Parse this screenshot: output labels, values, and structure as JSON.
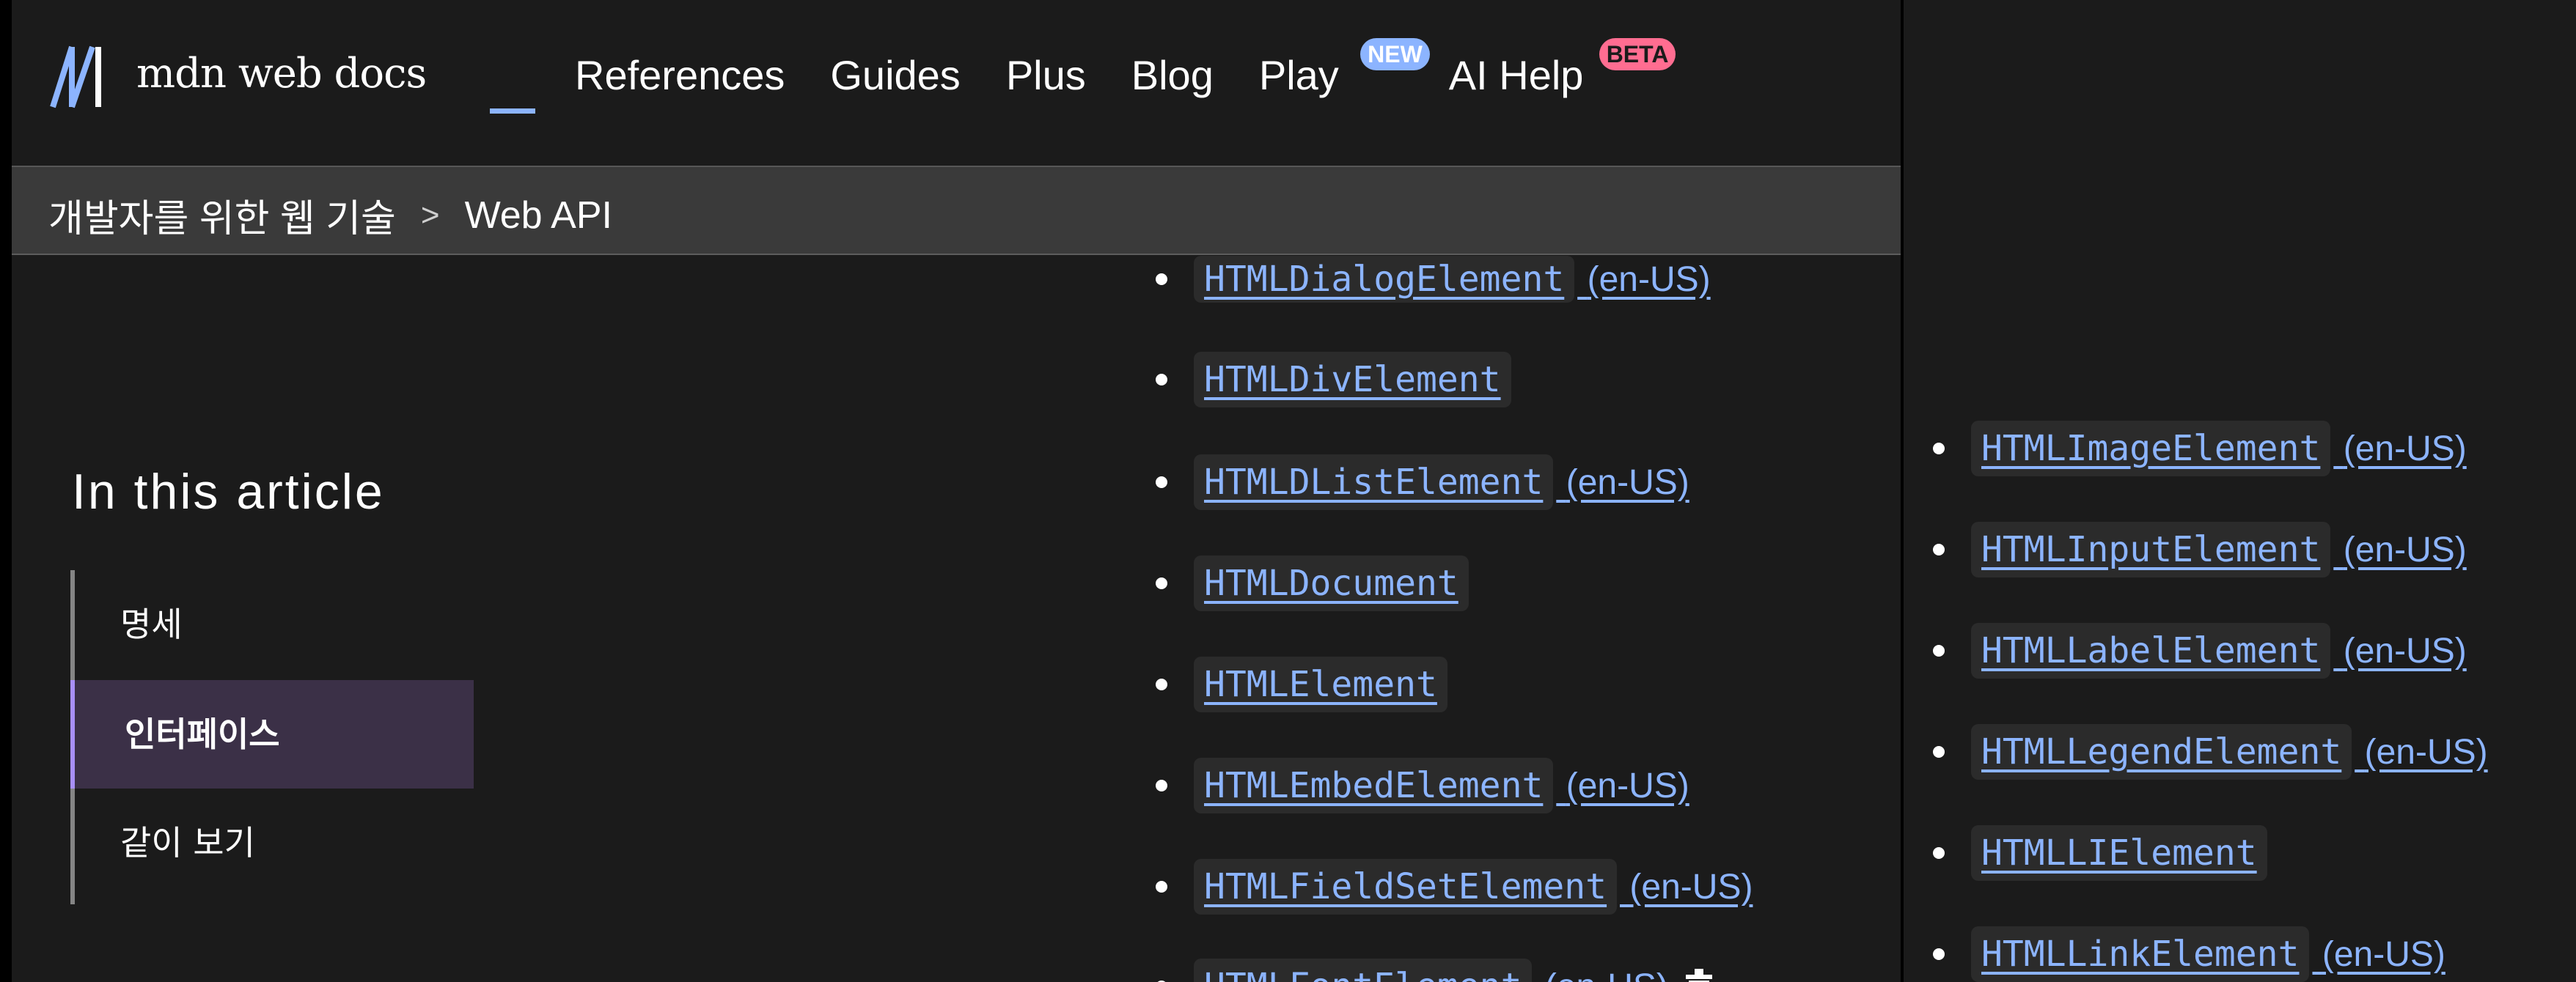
{
  "header": {
    "logo_text": "mdn web docs",
    "nav": [
      {
        "label": "References"
      },
      {
        "label": "Guides"
      },
      {
        "label": "Plus"
      },
      {
        "label": "Blog"
      },
      {
        "label": "Play",
        "badge": "NEW"
      },
      {
        "label": "AI Help",
        "badge": "BETA"
      }
    ],
    "colors": {
      "background": "#1b1b1b",
      "link": "#8cb4ff",
      "badge_new": "#8cb4ff",
      "badge_beta": "#ff6d91"
    }
  },
  "breadcrumb": {
    "items": [
      "개발자를 위한 웹 기술",
      "Web API"
    ],
    "separator": ">"
  },
  "sidebar": {
    "heading": "In this article",
    "items": [
      {
        "label": "명세",
        "active": false
      },
      {
        "label": "인터페이스",
        "active": true
      },
      {
        "label": "같이 보기",
        "active": false
      }
    ],
    "active_color": "#a88ff7"
  },
  "main_list": [
    {
      "name": "HTMLDialogElement",
      "lang": "(en-US)"
    },
    {
      "name": "HTMLDivElement",
      "lang": ""
    },
    {
      "name": "HTMLDListElement",
      "lang": "(en-US)"
    },
    {
      "name": "HTMLDocument",
      "lang": ""
    },
    {
      "name": "HTMLElement",
      "lang": ""
    },
    {
      "name": "HTMLEmbedElement",
      "lang": "(en-US)"
    },
    {
      "name": "HTMLFieldSetElement",
      "lang": "(en-US)"
    },
    {
      "name": "HTMLFontElement",
      "lang": "(en-US)",
      "icon": "trash-icon"
    }
  ],
  "side_list": [
    {
      "name": "HTMLImageElement",
      "lang": "(en-US)"
    },
    {
      "name": "HTMLInputElement",
      "lang": "(en-US)"
    },
    {
      "name": "HTMLLabelElement",
      "lang": "(en-US)"
    },
    {
      "name": "HTMLLegendElement",
      "lang": "(en-US)"
    },
    {
      "name": "HTMLLIElement",
      "lang": ""
    },
    {
      "name": "HTMLLinkElement",
      "lang": "(en-US)"
    }
  ]
}
